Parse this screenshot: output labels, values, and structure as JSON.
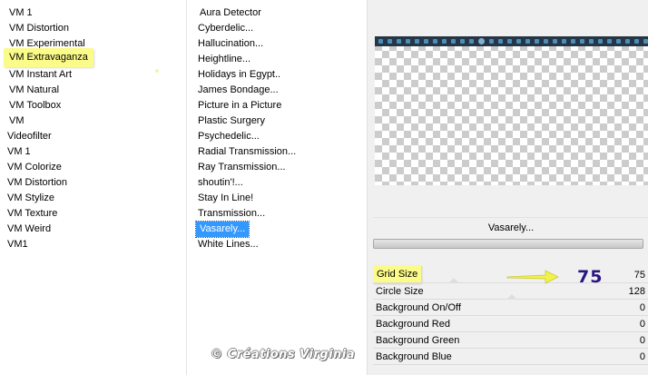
{
  "categories": [
    "VM 1",
    "VM Distortion",
    "VM Experimental",
    "VM Extravaganza",
    "VM Instant Art",
    "VM Natural",
    "VM Toolbox",
    "VM",
    "Videofilter",
    "VM 1",
    "VM Colorize",
    "VM Distortion",
    "VM Stylize",
    "VM Texture",
    "VM Weird",
    "VM1"
  ],
  "filters": [
    "Aura Detector",
    "Cyberdelic...",
    "Hallucination...",
    "Heightline...",
    "Holidays in Egypt..",
    "James Bondage...",
    "Picture in a Picture",
    "Plastic Surgery",
    "Psychedelic...",
    "Radial Transmission...",
    "Ray Transmission...",
    "shoutin'!...",
    "Stay In Line!",
    "Transmission...",
    "Vasarely...",
    "White Lines..."
  ],
  "effect_title": "Vasarely...",
  "params": [
    {
      "name": "Grid Size",
      "value": "75"
    },
    {
      "name": "Circle Size",
      "value": "128"
    },
    {
      "name": "Background On/Off",
      "value": "0"
    },
    {
      "name": "Background Red",
      "value": "0"
    },
    {
      "name": "Background Green",
      "value": "0"
    },
    {
      "name": "Background Blue",
      "value": "0"
    }
  ],
  "slider_levels": [
    0.294,
    0.502,
    0,
    0,
    0,
    0
  ],
  "annotation_value": "75",
  "watermark": "© Créations Virginia",
  "colors": {
    "highlight_yellow": "#fbfb8a",
    "selection_blue": "#3399ff",
    "annotation_text": "#2a1580",
    "arrow_yellow": "#f2f24a"
  }
}
